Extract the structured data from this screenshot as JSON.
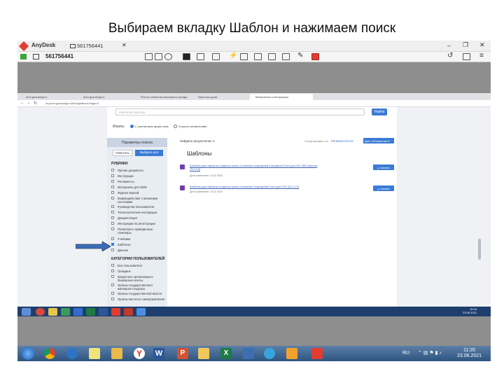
{
  "slide": {
    "title": "Выбираем вкладку Шаблон и нажимаем поиск"
  },
  "anydesk": {
    "app_name": "AnyDesk",
    "tab_id": "561756441",
    "session_id": "561756441"
  },
  "browser": {
    "tabs": [
      "dom.gosuslugi.ru",
      "dom.gosuslugi.ru",
      "Реестр объектов жилищного фонда",
      "Карточка дома",
      "Материалы и инструкции"
    ],
    "url": "my.dom.gosuslugi.ru/#!/regulations?tags=0"
  },
  "page": {
    "search_placeholder": "Найти на портале",
    "search_button": "Найти",
    "search_scope_label": "Искать:",
    "scope_options": [
      "С учетом всех форм слов",
      "Строгое соответствие"
    ],
    "sidebar_header": "Параметры поиска",
    "clear_button": "Очистить",
    "select_all_button": "Выбрать все",
    "rubrics_title": "РУБРИКИ",
    "rubrics": [
      {
        "label": "Прочие документы",
        "checked": false
      },
      {
        "label": "Инструкции",
        "checked": false
      },
      {
        "label": "Регламенты",
        "checked": false
      },
      {
        "label": "Материалы для ОМИ",
        "checked": false
      },
      {
        "label": "Журнал версий",
        "checked": false
      },
      {
        "label": "Взаимодействие с внешними системами",
        "checked": false
      },
      {
        "label": "Руководства пользователя",
        "checked": false
      },
      {
        "label": "Технологические инструкции",
        "checked": false
      },
      {
        "label": "Документация",
        "checked": false
      },
      {
        "label": "Инструкции по регистрации",
        "checked": false
      },
      {
        "label": "Посмотреть проведенные семинары",
        "checked": false
      },
      {
        "label": "Учебники",
        "checked": false
      },
      {
        "label": "Шаблоны",
        "checked": true
      },
      {
        "label": "Данные",
        "checked": false
      }
    ],
    "users_title": "КАТЕГОРИИ ПОЛЬЗОВАТЕЛЕЙ",
    "user_categories": [
      {
        "label": "Все пользователи",
        "checked": false
      },
      {
        "label": "Граждане",
        "checked": false
      },
      {
        "label": "Кредитные организации и банковские агенты",
        "checked": false
      },
      {
        "label": "Органы государственного жилищного надзора",
        "checked": false
      },
      {
        "label": "Органы государственной власти",
        "checked": false
      },
      {
        "label": "Органы местного самоуправления",
        "checked": false
      }
    ],
    "results_count": "Найдено результатов: 2",
    "sort_label": "Отсортировать по:",
    "sort_relevance": "Релевантности",
    "sort_date": "Дате обновления",
    "section_heading": "Шаблоны",
    "results": [
      {
        "title": "Шаблоны для импорта в кадастр жилых и нежилых помещений в формате Excel для ГИС ЖКХ (версия 13.1.0.3)",
        "date": "Дата изменения: 14.02.2020",
        "download": "Скачать"
      },
      {
        "title": "Шаблоны для импорта в кадастр жилых и нежилых помещений Excel для ГИС (13.1.0.3)",
        "date": "Дата изменения: 14.02.2020",
        "download": "Скачать"
      }
    ]
  },
  "remote_tray": {
    "time": "16:16",
    "date": "23.06.2021"
  },
  "local_tray": {
    "lang": "RU",
    "time": "11:20",
    "date": "23.06.2021"
  }
}
